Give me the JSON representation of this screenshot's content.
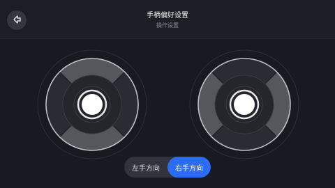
{
  "header": {
    "title": "手柄偏好设置",
    "subtitle": "操作设置",
    "back_icon": "arrow-left-icon"
  },
  "sticks": [
    {
      "name": "left-joystick",
      "highlight": "top-bottom"
    },
    {
      "name": "right-joystick",
      "highlight": "left-right"
    }
  ],
  "toggle": {
    "left_label": "左手方向",
    "right_label": "右手方向",
    "selected": "右手方向"
  },
  "colors": {
    "background": "#181a21",
    "accent": "#2b6cf3",
    "sector_highlight": "#5a5c62",
    "sector_dim": "#2e3037"
  }
}
